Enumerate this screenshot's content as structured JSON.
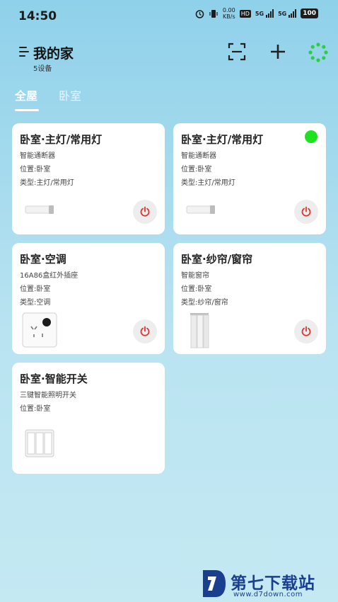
{
  "status_bar": {
    "time": "14:50",
    "speed_value": "0.00",
    "speed_unit": "KB/s",
    "hd": "HD",
    "net1": "5G",
    "net2": "5G",
    "battery": "100"
  },
  "header": {
    "title": "我的家",
    "device_count": "5设备"
  },
  "tabs": [
    {
      "label": "全屋",
      "active": true
    },
    {
      "label": "卧室",
      "active": false
    }
  ],
  "devices": [
    {
      "name": "卧室·主灯/常用灯",
      "model": "智能通断器",
      "location": "位置:卧室",
      "type": "类型:主灯/常用灯",
      "online": false,
      "thumb": "breaker"
    },
    {
      "name": "卧室·主灯/常用灯",
      "model": "智能通断器",
      "location": "位置:卧室",
      "type": "类型:主灯/常用灯",
      "online": true,
      "thumb": "breaker"
    },
    {
      "name": "卧室·空调",
      "model": "16A86盒红外插座",
      "location": "位置:卧室",
      "type": "类型:空调",
      "online": false,
      "thumb": "socket"
    },
    {
      "name": "卧室·纱帘/窗帘",
      "model": "智能窗帘",
      "location": "位置:卧室",
      "type": "类型:纱帘/窗帘",
      "online": false,
      "thumb": "curtain"
    },
    {
      "name": "卧室·智能开关",
      "model": "三键智能照明开关",
      "location": "位置:卧室",
      "online": false,
      "thumb": "switch"
    }
  ],
  "colors": {
    "online": "#1fe21f",
    "power_icon": "#e0322e",
    "accent_green": "#2ecc40",
    "watermark": "#1b3f8f"
  },
  "watermark": {
    "text": "第七下载站",
    "url": "www.d7down.com"
  }
}
